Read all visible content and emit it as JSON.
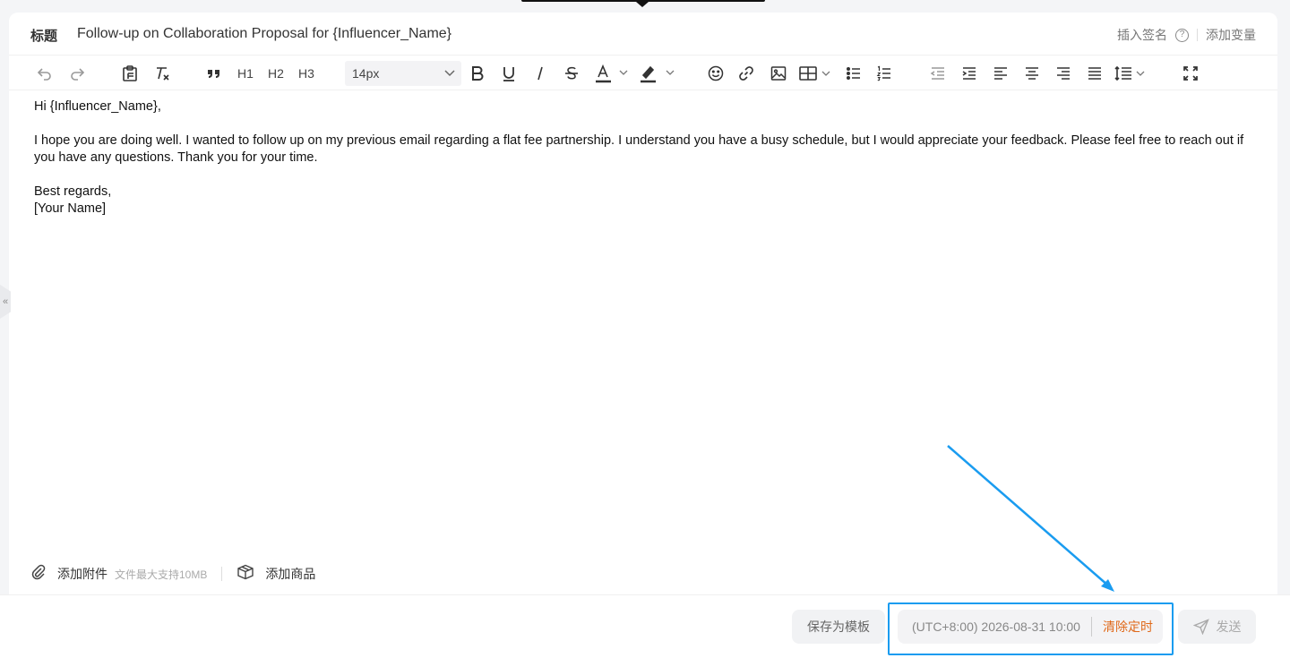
{
  "subject": {
    "label": "标题",
    "value": "Follow-up on Collaboration Proposal for {Influencer_Name}",
    "insert_signature": "插入签名",
    "add_variable": "添加变量"
  },
  "toolbar": {
    "h1": "H1",
    "h2": "H2",
    "h3": "H3",
    "font_size": "14px"
  },
  "body": {
    "lines": [
      "Hi {Influencer_Name},",
      "",
      "I hope you are doing well. I wanted to follow up on my previous email regarding a flat fee partnership. I understand you have a busy schedule, but I would appreciate your feedback. Please feel free to reach out if you have any questions. Thank you for your time.",
      "",
      "Best regards,",
      "[Your Name]"
    ]
  },
  "attachments": {
    "add_attachment": "添加附件",
    "hint": "文件最大支持10MB",
    "add_product": "添加商品"
  },
  "footer": {
    "save_template": "保存为模板",
    "schedule_time": "(UTC+8:00) 2026-08-31 10:00",
    "clear_schedule": "清除定时",
    "send": "发送"
  },
  "colors": {
    "highlight": "#1a9cf0",
    "clear_schedule": "#e06a1b"
  }
}
